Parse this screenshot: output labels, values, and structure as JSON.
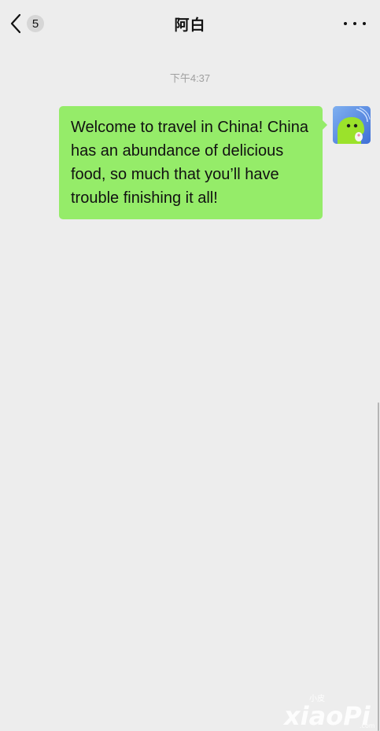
{
  "header": {
    "back_label": "back",
    "unread_count": "5",
    "title": "阿白",
    "more_label": "more"
  },
  "chat": {
    "timestamp": "下午4:37",
    "messages": [
      {
        "sender": "self",
        "text": "Welcome to travel in China! China has an abundance of delicious food, so much that you’ll have trouble finishing it all!",
        "bubble_color": "#95ec69"
      }
    ]
  },
  "watermark": {
    "text": "xiaoPi",
    "small_text": "小皮",
    "suffix": ".com"
  },
  "colors": {
    "background": "#ededed",
    "bubble": "#95ec69",
    "avatar_bg": "#5a8fe0",
    "avatar_figure": "#9be22b"
  }
}
